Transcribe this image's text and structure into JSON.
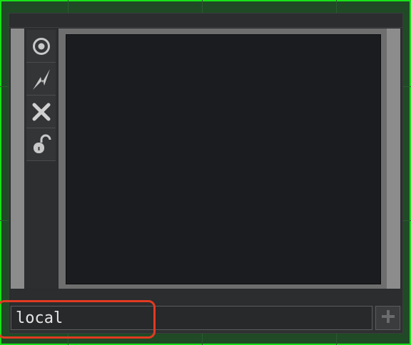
{
  "toolbar": {
    "buttons": [
      {
        "icon": "target-icon"
      },
      {
        "icon": "lightning-icon"
      },
      {
        "icon": "close-icon"
      },
      {
        "icon": "unlock-icon"
      }
    ]
  },
  "footer": {
    "name_value": "local",
    "add_icon": "plus-icon"
  },
  "colors": {
    "frame_border": "#18e018",
    "highlight": "#e23a22",
    "viewer_bg": "#1b1c1f"
  }
}
